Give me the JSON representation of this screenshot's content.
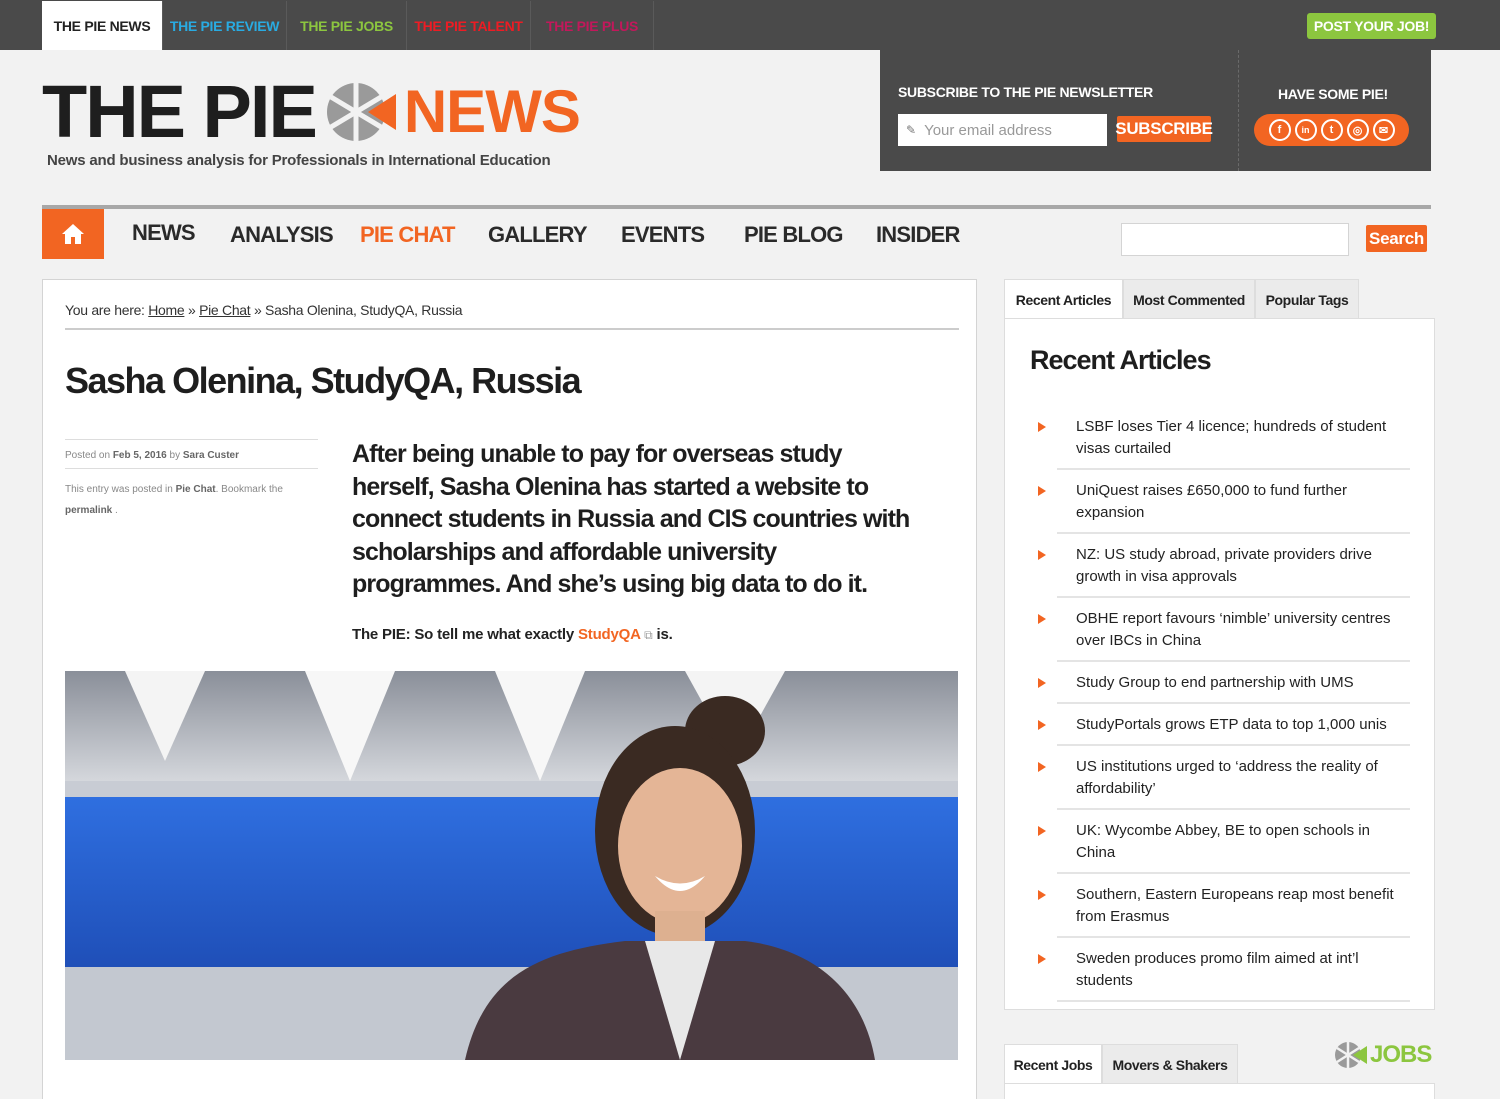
{
  "topbar": {
    "tabs": [
      {
        "label": "THE PIE NEWS",
        "color": "#222222"
      },
      {
        "label": "THE PIE REVIEW",
        "color": "#29abe2"
      },
      {
        "label": "THE PIE JOBS",
        "color": "#8cc63f"
      },
      {
        "label": "THE PIE TALENT",
        "color": "#ed1c24"
      },
      {
        "label": "THE PIE PLUS",
        "color": "#c2185b"
      }
    ],
    "post_job": "POST YOUR JOB!"
  },
  "logo": {
    "part1": "THE PIE",
    "part2": "NEWS",
    "tagline": "News and business analysis for Professionals in International Education"
  },
  "newsletter": {
    "title": "SUBSCRIBE TO THE PIE NEWSLETTER",
    "placeholder": "Your email address",
    "button": "SUBSCRIBE",
    "have_pie": "HAVE SOME PIE!"
  },
  "socials": [
    {
      "icon": "facebook-icon",
      "glyph": "f"
    },
    {
      "icon": "linkedin-icon",
      "glyph": "in"
    },
    {
      "icon": "twitter-icon",
      "glyph": "t"
    },
    {
      "icon": "instagram-icon",
      "glyph": "◎"
    },
    {
      "icon": "email-icon",
      "glyph": "✉"
    }
  ],
  "nav": {
    "items": [
      "NEWS",
      "ANALYSIS",
      "PIE CHAT",
      "GALLERY",
      "EVENTS",
      "PIE BLOG",
      "INSIDER"
    ],
    "active": "PIE CHAT",
    "search_button": "Search"
  },
  "breadcrumb": {
    "prefix": "You are here: ",
    "home": "Home",
    "sep": " » ",
    "section": "Pie Chat",
    "current": "Sasha Olenina, StudyQA, Russia"
  },
  "article": {
    "title": "Sasha Olenina, StudyQA, Russia",
    "posted_on_label": "Posted on ",
    "date": "Feb 5, 2016",
    "by_label": " by ",
    "author": "Sara Custer",
    "entry_label": "This entry was posted in ",
    "category": "Pie Chat",
    "bookmark_label": ". Bookmark the ",
    "permalink": "permalink",
    "permalink_suffix": " .",
    "lede": "After being unable to pay for overseas study herself, Sasha Olenina has started a website to connect students in Russia and CIS countries with scholarships and affordable university programmes. And she’s using big data to do it.",
    "question_prefix": "The PIE: So tell me what exactly ",
    "question_link": "StudyQA",
    "question_suffix": " is."
  },
  "sidebar": {
    "tabs": [
      "Recent Articles",
      "Most Commented",
      "Popular Tags"
    ],
    "title": "Recent Articles",
    "articles": [
      "LSBF loses Tier 4 licence; hundreds of student visas curtailed",
      "UniQuest raises £650,000 to fund further expansion",
      "NZ: US study abroad, private providers drive growth in visa approvals",
      "OBHE report favours ‘nimble’ university centres over IBCs in China",
      "Study Group to end partnership with UMS",
      "StudyPortals grows ETP data to top 1,000 unis",
      "US institutions urged to ‘address the reality of affordability’",
      "UK: Wycombe Abbey, BE to open schools in China",
      "Southern, Eastern Europeans reap most benefit from Erasmus",
      "Sweden produces promo film aimed at int’l students"
    ],
    "tabs2": [
      "Recent Jobs",
      "Movers & Shakers"
    ],
    "jobs_logo": "JOBS"
  }
}
